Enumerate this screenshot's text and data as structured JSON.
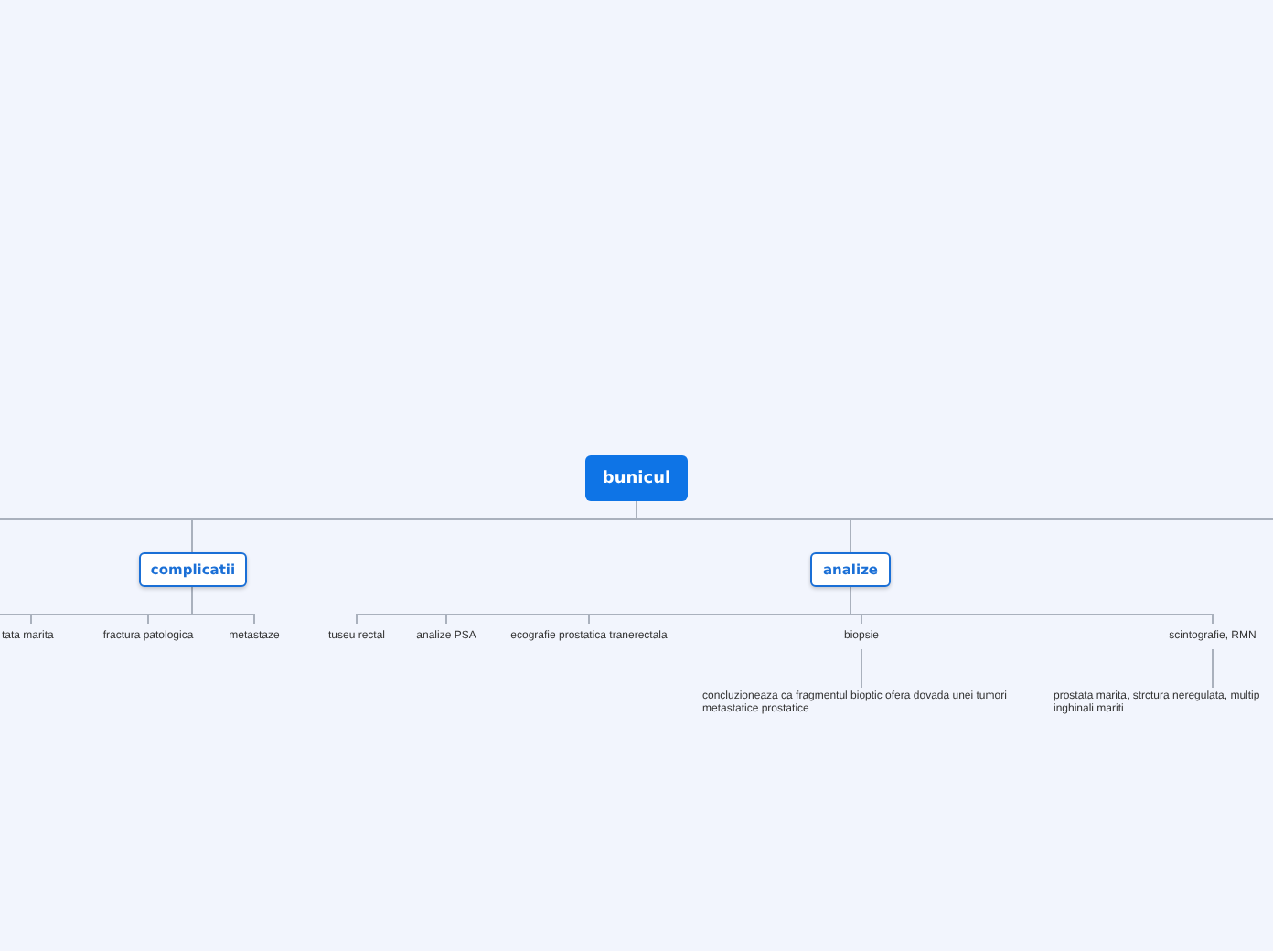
{
  "root": {
    "label": "bunicul",
    "children": [
      {
        "label": "complicatii",
        "children": [
          {
            "label": "tata marita"
          },
          {
            "label": "fractura patologica"
          },
          {
            "label": "metastaze"
          }
        ]
      },
      {
        "label": "analize",
        "children": [
          {
            "label": "tuseu rectal"
          },
          {
            "label": "analize PSA"
          },
          {
            "label": "ecografie prostatica tranerectala"
          },
          {
            "label": "biopsie",
            "children": [
              {
                "lines": [
                  "concluzioneaza ca fragmentul bioptic ofera dovada unei tumori",
                  "metastatice prostatice"
                ]
              }
            ]
          },
          {
            "label": "scintografie, RMN",
            "children": [
              {
                "lines": [
                  "prostata marita, strctura neregulata, multip",
                  "inghinali mariti"
                ]
              }
            ]
          }
        ]
      }
    ]
  }
}
